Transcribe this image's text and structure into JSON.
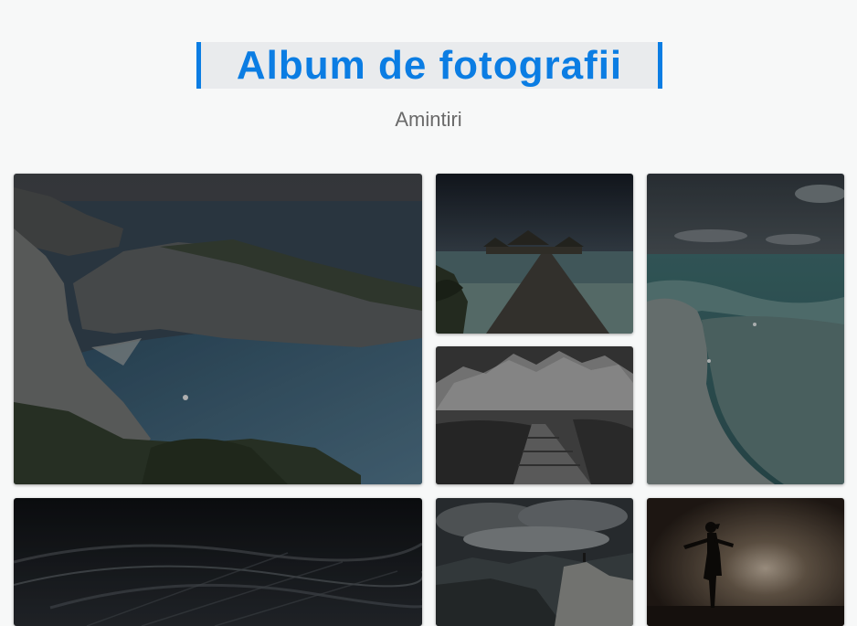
{
  "header": {
    "title": "Album de fotografii",
    "subtitle": "Amintiri"
  },
  "colors": {
    "accent": "#0b7de3",
    "page_background": "#f7f8f8",
    "title_background": "#e9ebed",
    "subtitle_text": "#6a6a6a"
  },
  "gallery": {
    "photos": [
      {
        "subject": "coastal cliffs bay"
      },
      {
        "subject": "overwater bungalows pier"
      },
      {
        "subject": "turquoise lagoon sandbank"
      },
      {
        "subject": "mountain stone path"
      },
      {
        "subject": "wispy cloud sky"
      },
      {
        "subject": "hiker on rocky peak"
      },
      {
        "subject": "silhouette at sunset"
      }
    ]
  }
}
